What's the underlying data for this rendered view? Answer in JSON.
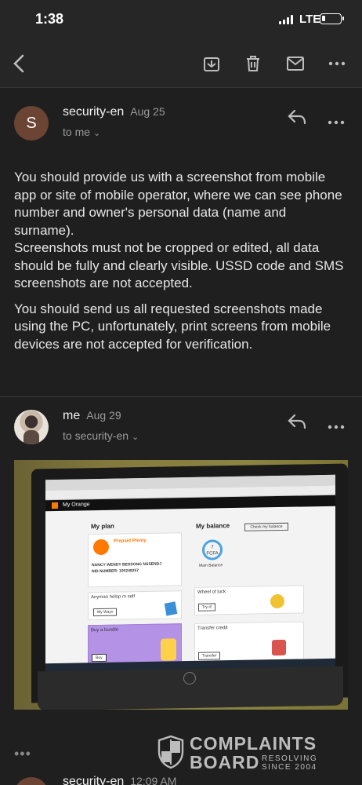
{
  "status_bar": {
    "time": "1:38",
    "network": "LTE",
    "battery_level": 0.2
  },
  "toolbar": {
    "back_icon": "chevron-left-icon",
    "archive_icon": "archive-icon",
    "delete_icon": "trash-icon",
    "mark_unread_icon": "mail-icon",
    "more_icon": "more-horizontal-icon"
  },
  "messages": [
    {
      "avatar_letter": "S",
      "sender": "security-en",
      "date": "Aug 25",
      "to": "to me",
      "body": [
        "You should provide us with a screenshot from mobile app or site of mobile operator, where we can see phone number and owner's personal data (name and surname).\nScreenshots must not be cropped or edited, all data should be fully and clearly visible. USSD code and SMS screenshots are not accepted.",
        "You should send us all requested screenshots made using the PC, unfortunately, print screens from mobile devices are not accepted for verification."
      ]
    },
    {
      "sender": "me",
      "date": "Aug 29",
      "to": "to security-en"
    },
    {
      "sender": "security-en",
      "date": "12:09 AM"
    }
  ],
  "attachment": {
    "browser_brand": "My Orange",
    "my_plan": "My plan",
    "plan_name": "Prepaid Plenty",
    "subscriber_name": "NANCY WENDY BESSONG NSSENDJ",
    "msisdn": "NID NUMBER: 100248257",
    "my_balance": "My balance",
    "balance_value": "7",
    "balance_currency": "FCFA",
    "main_balance": "Main Balance",
    "check_balance": "Check my balance",
    "help_panel": "Anyman helop m self",
    "wheel_of_luck": "Wheel of luck",
    "buy_bundle": "Buy a bundle",
    "transfer_credit": "Transfer credit",
    "my_ways": "My Ways",
    "try_it": "Try it!",
    "buy": "Buy",
    "transfer": "Transfer"
  },
  "watermark": {
    "line1": "COMPLAINTS",
    "line2": "BOARD",
    "tag1": "RESOLVING",
    "tag2": "SINCE 2004"
  },
  "more_quoted": "•••"
}
